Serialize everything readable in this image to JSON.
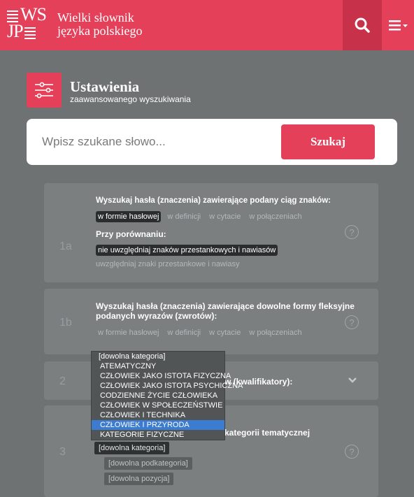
{
  "header": {
    "logo_line1": "WS",
    "logo_line2": "JP",
    "title_line1": "Wielki słownik",
    "title_line2": "języka polskiego",
    "search_icon": "search-icon",
    "menu_icon": "hamburger-menu-icon"
  },
  "settings": {
    "title": "Ustawienia",
    "subtitle": "zaawansowanego wyszukiwania"
  },
  "search": {
    "placeholder": "Wpisz szukane słowo...",
    "button": "Szukaj"
  },
  "card_1a": {
    "num": "1a",
    "question": "Wyszukaj hasła (znaczenia) zawierające podany ciąg znaków:",
    "options": [
      "w formie hasłowej",
      "w definicji",
      "w cytacie",
      "w połączeniach"
    ],
    "compare_label": "Przy porównaniu:",
    "compare_on": "nie uwzględniaj znaków przestankowych i nawiasów",
    "compare_off": "uwzględniaj znaki przestankowe i nawiasy"
  },
  "card_1b": {
    "num": "1b",
    "question_line1": "Wyszukaj hasła (znaczenia) zawierające dowolne formy fleksyjne",
    "question_line2": "podanych wyrazów (zwrotów):",
    "options": [
      "w formie hasłowej",
      "w definicji",
      "w cytacie",
      "w połączeniach"
    ]
  },
  "card_2": {
    "num": "2",
    "question_tail": "w (kwalifikatory):"
  },
  "card_3": {
    "num": "3",
    "question_tail": "kategorii tematycznej",
    "select_category": "[dowolna kategoria]",
    "select_subcategory": "[dowolna podkategoria]",
    "select_position": "[dowolna pozycja]"
  },
  "dropdown": {
    "items": [
      "[dowolna kategoria]",
      "ATEMATYCZNY",
      "CZŁOWIEK JAKO ISTOTA FIZYCZNA",
      "CZŁOWIEK JAKO ISTOTA PSYCHICZNA",
      "CODZIENNE ŻYCIE CZŁOWIEKA",
      "CZŁOWIEK W SPOŁECZEŃSTWIE",
      "CZŁOWIEK I TECHNIKA",
      "CZŁOWIEK I PRZYRODA",
      "KATEGORIE FIZYCZNE"
    ],
    "selected_index": 7
  },
  "colors": {
    "brand": "#e5405a",
    "brand_dark": "#c7324a",
    "background": "#6f7273",
    "card": "#7b7f80",
    "dropdown_selected": "#3b7bd0"
  }
}
